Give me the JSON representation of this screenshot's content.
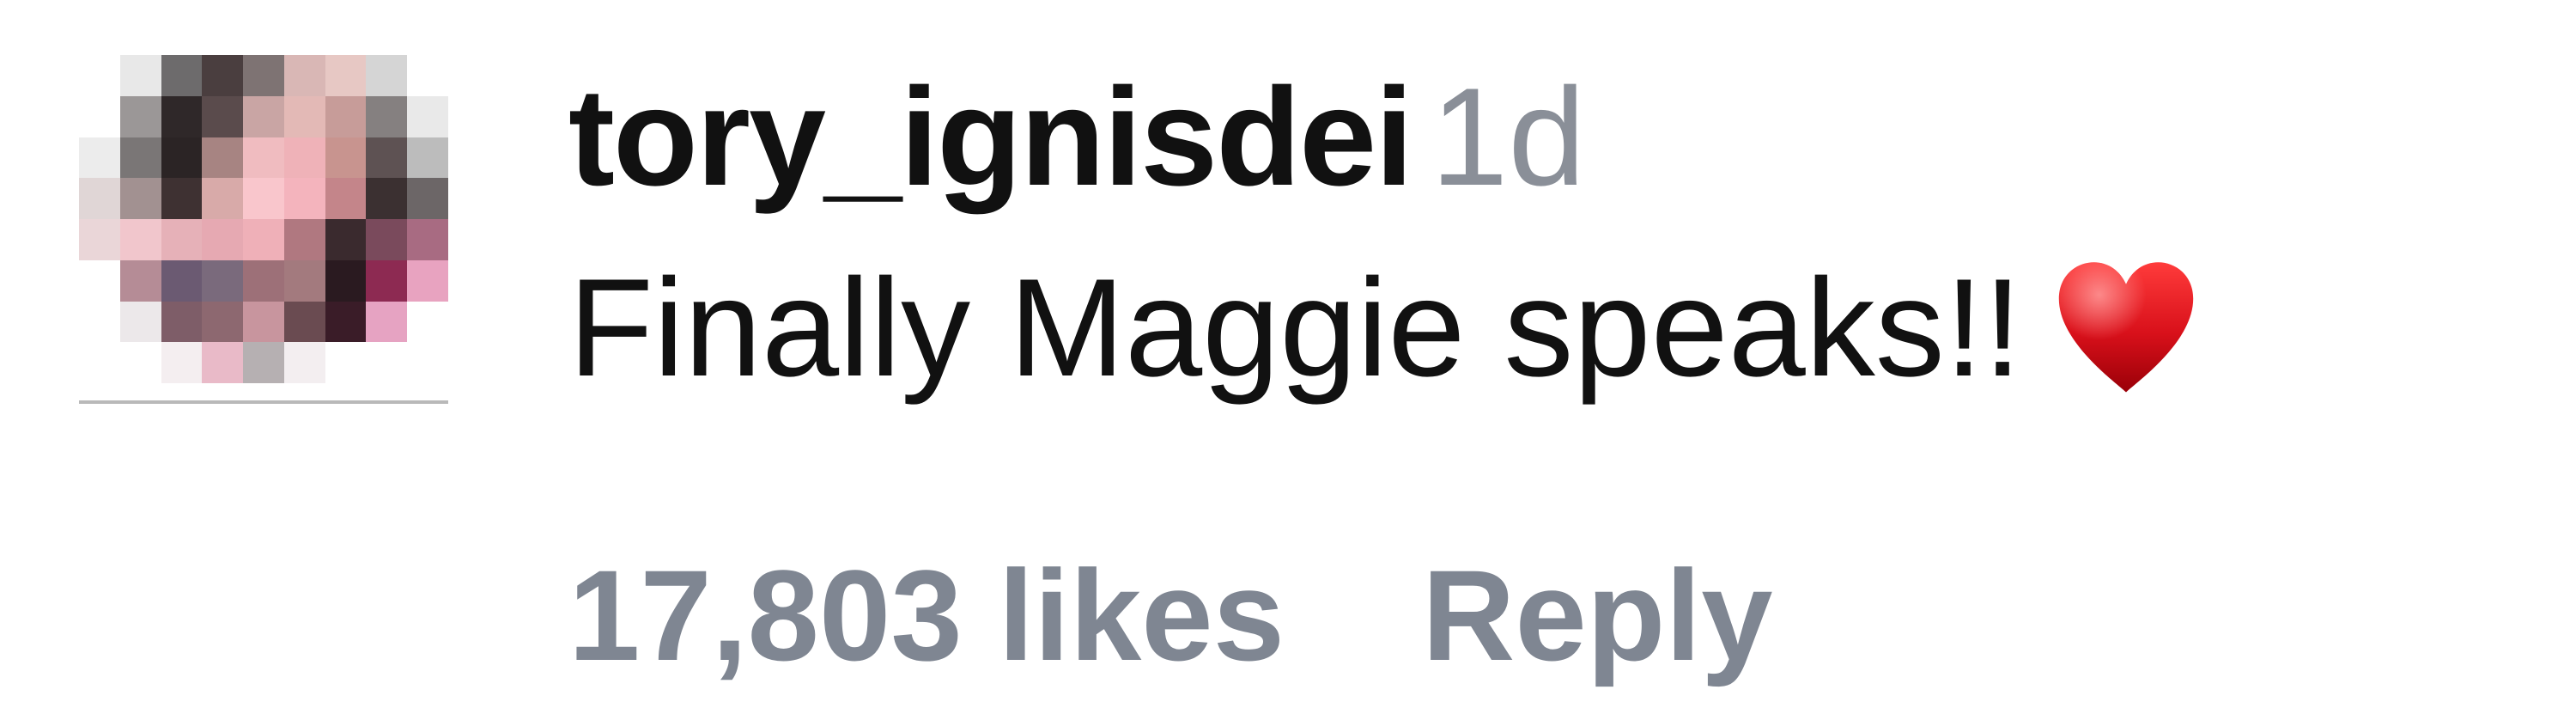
{
  "comment": {
    "username": "tory_ignisdei",
    "timestamp": "1d",
    "text": "Finally Maggie speaks!!",
    "emoji_icon": "red-heart-icon",
    "likes_label": "17,803 likes",
    "reply_label": "Reply",
    "avatar_icon": "pixelated-avatar"
  },
  "colors": {
    "username": "#111111",
    "secondary_text": "#8a8f98",
    "action_text": "#7f8692",
    "heart": "#d8101a"
  }
}
